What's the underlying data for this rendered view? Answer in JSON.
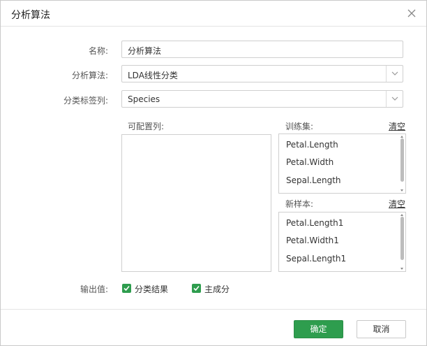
{
  "dialog": {
    "title": "分析算法"
  },
  "form": {
    "name_label": "名称:",
    "name_value": "分析算法",
    "algorithm_label": "分析算法:",
    "algorithm_value": "LDA线性分类",
    "class_label_label": "分类标签列:",
    "class_label_value": "Species"
  },
  "configurable": {
    "title": "可配置列:",
    "items": []
  },
  "training": {
    "title": "训练集:",
    "clear_label": "清空",
    "items": [
      "Petal.Length",
      "Petal.Width",
      "Sepal.Length"
    ]
  },
  "new_sample": {
    "title": "新样本:",
    "clear_label": "清空",
    "items": [
      "Petal.Length1",
      "Petal.Width1",
      "Sepal.Length1"
    ]
  },
  "output": {
    "label": "输出值:",
    "options": [
      {
        "label": "分类结果",
        "checked": true
      },
      {
        "label": "主成分",
        "checked": true
      }
    ]
  },
  "buttons": {
    "ok": "确定",
    "cancel": "取消"
  },
  "colors": {
    "accent": "#2e9d4e"
  }
}
